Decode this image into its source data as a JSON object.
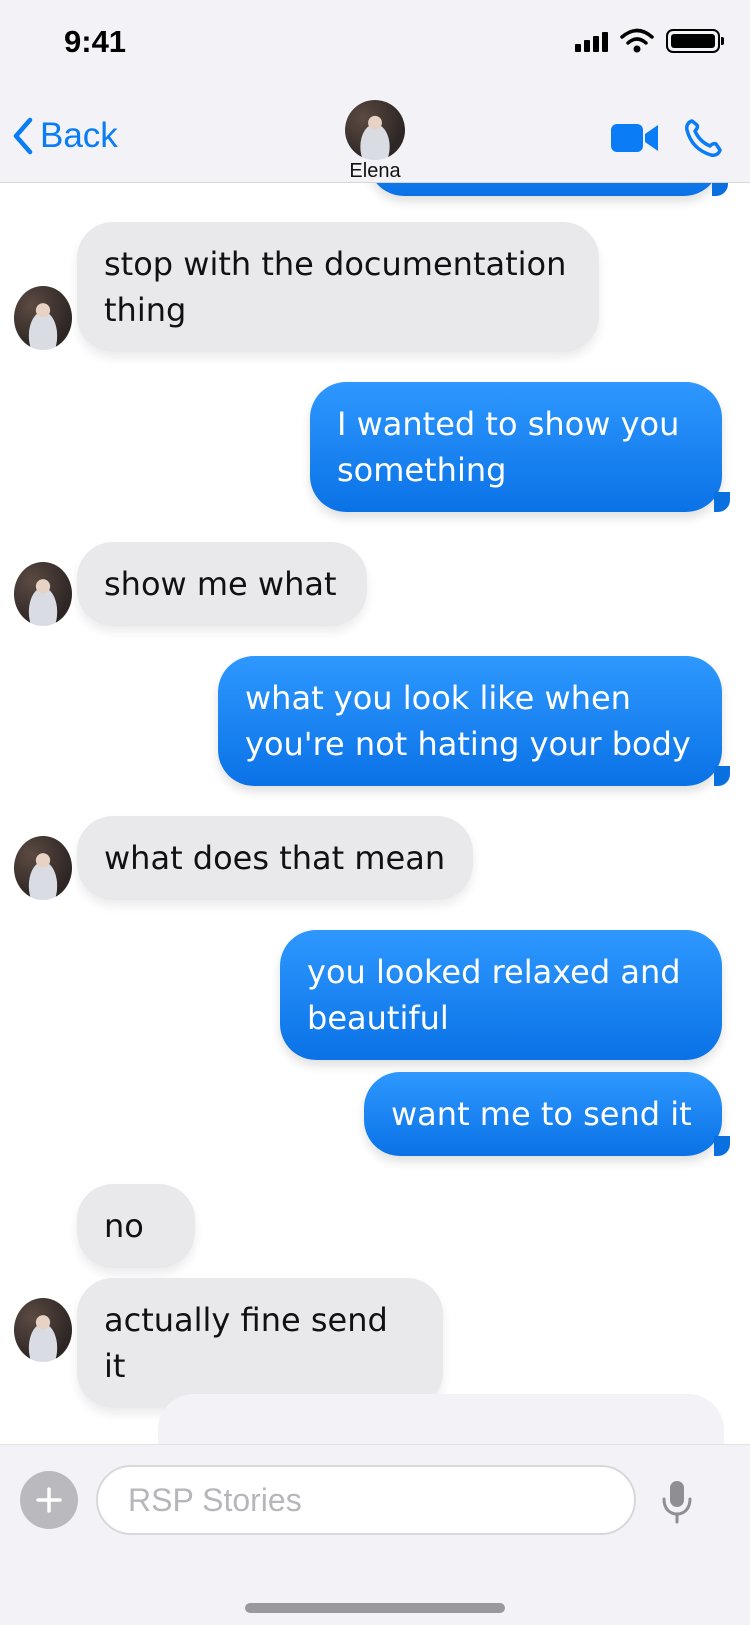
{
  "status_bar": {
    "time": "9:41"
  },
  "header": {
    "back_label": "Back",
    "contact_name": "Elena",
    "icons": [
      "chevron-left-icon",
      "video-camera-icon",
      "phone-icon"
    ]
  },
  "colors": {
    "accent": "#0a7cf5",
    "sent_bubble": "#1a86f5",
    "received_bubble": "#e9e9eb",
    "background": "#ffffff",
    "bar_background": "#f2f2f7"
  },
  "messages": [
    {
      "direction": "received",
      "text": "stop with the documentation thing"
    },
    {
      "direction": "sent",
      "text": "I wanted to show you something"
    },
    {
      "direction": "received",
      "text": "show me what"
    },
    {
      "direction": "sent",
      "text": "what you look like when you're not hating your body"
    },
    {
      "direction": "received",
      "text": "what does that mean"
    },
    {
      "direction": "sent",
      "text": "you looked relaxed and beautiful"
    },
    {
      "direction": "sent",
      "text": "want me to send it"
    },
    {
      "direction": "received",
      "text": "no"
    },
    {
      "direction": "received",
      "text": "actually fine send it"
    }
  ],
  "composer": {
    "placeholder": "RSP Stories",
    "value": "",
    "icons": [
      "plus-icon",
      "microphone-icon"
    ]
  }
}
